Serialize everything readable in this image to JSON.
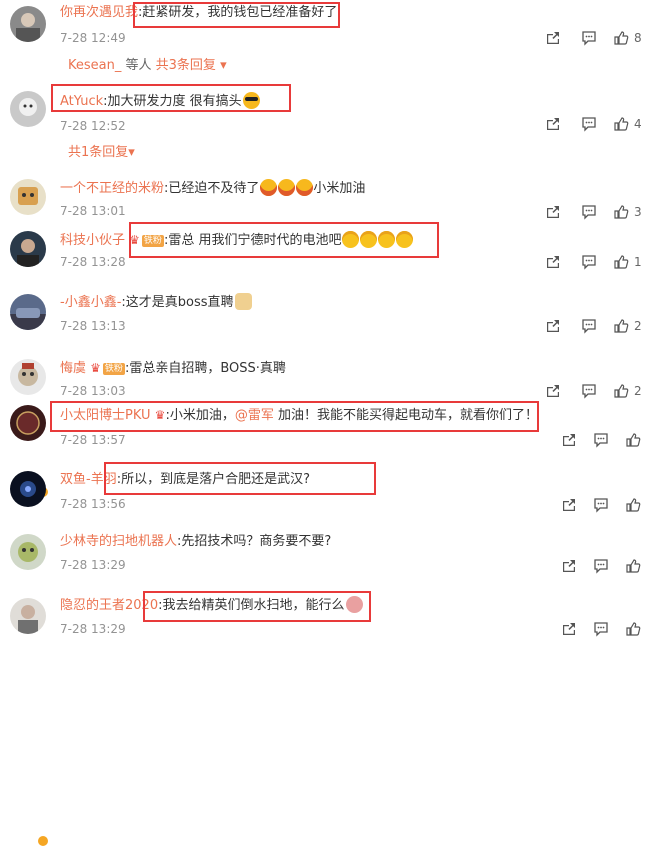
{
  "comments": [
    {
      "name": "你再次遇见我",
      "sep": ":",
      "text": "赶紧研发，我的钱包已经准备好了",
      "time": "7-28 12:49",
      "likes": "8"
    },
    {
      "name": "AtYuck",
      "sep": ":",
      "text": "加大研发力度 很有搞头",
      "time": "7-28 12:52",
      "likes": "4"
    },
    {
      "name": "一个不正经的米粉",
      "sep": ":",
      "text": "已经迫不及待了",
      "text2": "小米加油",
      "time": "7-28 13:01",
      "likes": "3"
    },
    {
      "name": "科技小伙子",
      "badge": "铁粉",
      "sep": ":",
      "text": "雷总 用我们宁德时代的电池吧",
      "time": "7-28 13:28",
      "likes": "1"
    },
    {
      "name": "-小鑫小鑫-",
      "sep": ":",
      "text": "这才是真boss直聘",
      "time": "7-28 13:13",
      "likes": "2"
    },
    {
      "name": "悔虞",
      "badge": "铁粉",
      "sep": ":",
      "text": "雷总亲自招聘，BOSS·真聘",
      "time": "7-28 13:03",
      "likes": "2"
    },
    {
      "name": "小太阳博士PKU",
      "sep": ":",
      "text": "小米加油，",
      "mention": "@雷军",
      "text2": " 加油！我能不能买得起电动车，就看你们了！",
      "time": "7-28 13:57"
    },
    {
      "name": "双鱼-羊羽",
      "sep": ":",
      "text": "所以，到底是落户合肥还是武汉?",
      "time": "7-28 13:56"
    },
    {
      "name": "少林寺的扫地机器人",
      "sep": ":",
      "text": "先招技术吗？商务要不要?",
      "time": "7-28 13:29"
    },
    {
      "name": "隐忍的王者2020",
      "sep": ":",
      "text": "我去给精英们倒水扫地，能行么",
      "time": "7-28 13:29"
    }
  ],
  "replies1": {
    "users": "Kesean_",
    "suffix": " 等人",
    "link": "共3条回复",
    "arrow": "▾"
  },
  "replies2": {
    "link": "共1条回复",
    "arrow": "▾"
  },
  "icons": {
    "share": "share-icon",
    "comment": "comment-icon",
    "like": "like-icon"
  },
  "colors": {
    "name": "#eb7350",
    "highlight_box": "#e83a3a",
    "meta": "#939393"
  }
}
